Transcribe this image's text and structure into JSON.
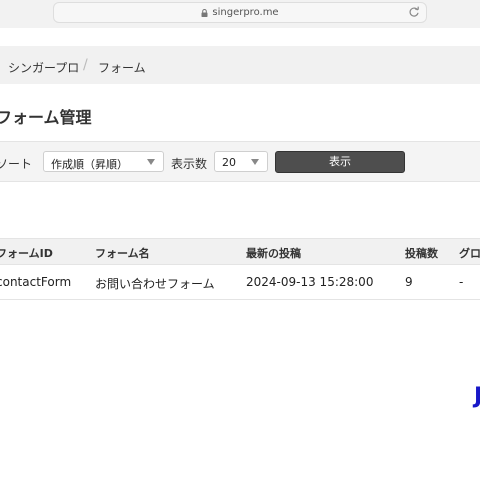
{
  "browser": {
    "url": "singerpro.me"
  },
  "breadcrumb": {
    "items": [
      "シンガープロ",
      "フォーム"
    ],
    "separator": "/"
  },
  "page": {
    "title": "フォーム管理"
  },
  "filters": {
    "sort_label": "ソート",
    "sort_value": "作成順（昇順）",
    "count_label": "表示数",
    "count_value": "20",
    "show_button": "表示"
  },
  "table": {
    "headers": [
      "フォームID",
      "フォーム名",
      "最新の投稿",
      "投稿数",
      "グロ"
    ],
    "rows": [
      {
        "id": "contactForm",
        "name": "お問い合わせフォーム",
        "latest": "2024-09-13 15:28:00",
        "count": "9",
        "extra": "-"
      }
    ]
  },
  "edge_glyph": "J",
  "colors": {
    "button_bg": "#4e4e4e",
    "accent_blue": "#1818c8"
  }
}
